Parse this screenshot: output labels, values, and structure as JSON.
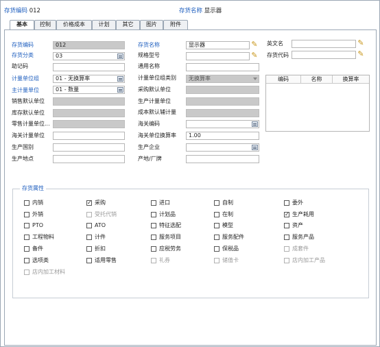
{
  "header": {
    "code_label": "存货编码",
    "code_value": "012",
    "name_label": "存货名称",
    "name_value": "显示器"
  },
  "tabs": [
    "基本",
    "控制",
    "价格成本",
    "计划",
    "其它",
    "图片",
    "附件"
  ],
  "form": {
    "code": {
      "label": "存货编码",
      "value": "012"
    },
    "category": {
      "label": "存货分类",
      "value": "03"
    },
    "mnemonic": {
      "label": "助记码",
      "value": ""
    },
    "uom_group": {
      "label": "计量单位组",
      "value": "01 - 无换算率"
    },
    "main_uom": {
      "label": "主计量单位",
      "value": "01 - 数量"
    },
    "sales_uom": {
      "label": "销售默认单位",
      "value": ""
    },
    "stock_uom": {
      "label": "库存默认单位",
      "value": ""
    },
    "retail_uom": {
      "label": "零售计量单位...",
      "value": ""
    },
    "customs_uom": {
      "label": "海关计量单位",
      "value": ""
    },
    "origin_country": {
      "label": "生产国别",
      "value": ""
    },
    "origin_place": {
      "label": "生产地点",
      "value": ""
    },
    "name": {
      "label": "存货名称",
      "value": "显示器"
    },
    "spec": {
      "label": "规格型号",
      "value": ""
    },
    "common_name": {
      "label": "通用名称",
      "value": ""
    },
    "uom_group_type": {
      "label": "计量单位组类别",
      "value": "无换算率"
    },
    "purchase_uom": {
      "label": "采购默认单位",
      "value": ""
    },
    "production_uom": {
      "label": "生产计量单位",
      "value": ""
    },
    "cost_aux_uom": {
      "label": "成本默认辅计量",
      "value": ""
    },
    "customs_code": {
      "label": "海关编码",
      "value": ""
    },
    "customs_rate": {
      "label": "海关单位换算率",
      "value": "1.00"
    },
    "manufacturer": {
      "label": "生产企业",
      "value": ""
    },
    "brand": {
      "label": "产地/厂牌",
      "value": ""
    },
    "english_name": {
      "label": "英文名",
      "value": ""
    },
    "inventory_code": {
      "label": "存货代码",
      "value": ""
    }
  },
  "grid": {
    "columns": [
      "编码",
      "名称",
      "换算率"
    ]
  },
  "attributes": {
    "title": "存货属性",
    "items": [
      {
        "label": "内销",
        "checked": false,
        "disabled": false
      },
      {
        "label": "采购",
        "checked": true,
        "disabled": false
      },
      {
        "label": "进口",
        "checked": false,
        "disabled": false
      },
      {
        "label": "自制",
        "checked": false,
        "disabled": false
      },
      {
        "label": "委外",
        "checked": false,
        "disabled": false
      },
      {
        "label": "外销",
        "checked": false,
        "disabled": false
      },
      {
        "label": "受托代销",
        "checked": false,
        "disabled": true
      },
      {
        "label": "计划品",
        "checked": false,
        "disabled": false
      },
      {
        "label": "在制",
        "checked": false,
        "disabled": false
      },
      {
        "label": "生产耗用",
        "checked": true,
        "disabled": false
      },
      {
        "label": "PTO",
        "checked": false,
        "disabled": false
      },
      {
        "label": "ATO",
        "checked": false,
        "disabled": false
      },
      {
        "label": "特征选配",
        "checked": false,
        "disabled": false
      },
      {
        "label": "模型",
        "checked": false,
        "disabled": false
      },
      {
        "label": "资产",
        "checked": false,
        "disabled": false
      },
      {
        "label": "工程物料",
        "checked": false,
        "disabled": false
      },
      {
        "label": "计件",
        "checked": false,
        "disabled": false
      },
      {
        "label": "服务项目",
        "checked": false,
        "disabled": false
      },
      {
        "label": "服务配件",
        "checked": false,
        "disabled": false
      },
      {
        "label": "服务产品",
        "checked": false,
        "disabled": false
      },
      {
        "label": "备件",
        "checked": false,
        "disabled": false
      },
      {
        "label": "折扣",
        "checked": false,
        "disabled": false
      },
      {
        "label": "应税劳务",
        "checked": false,
        "disabled": false
      },
      {
        "label": "保税品",
        "checked": false,
        "disabled": false
      },
      {
        "label": "成套件",
        "checked": false,
        "disabled": true
      },
      {
        "label": "选项类",
        "checked": false,
        "disabled": false
      },
      {
        "label": "适用零售",
        "checked": false,
        "disabled": false
      },
      {
        "label": "礼券",
        "checked": false,
        "disabled": true
      },
      {
        "label": "储值卡",
        "checked": false,
        "disabled": true
      },
      {
        "label": "店内加工产品",
        "checked": false,
        "disabled": true
      },
      {
        "label": "店内加工材料",
        "checked": false,
        "disabled": true
      }
    ]
  },
  "colors": {
    "accent": "#1f5fbf",
    "border": "#9aa6b4",
    "readonly_fill": "#c9c9c9",
    "pencil": "#c8961a"
  }
}
